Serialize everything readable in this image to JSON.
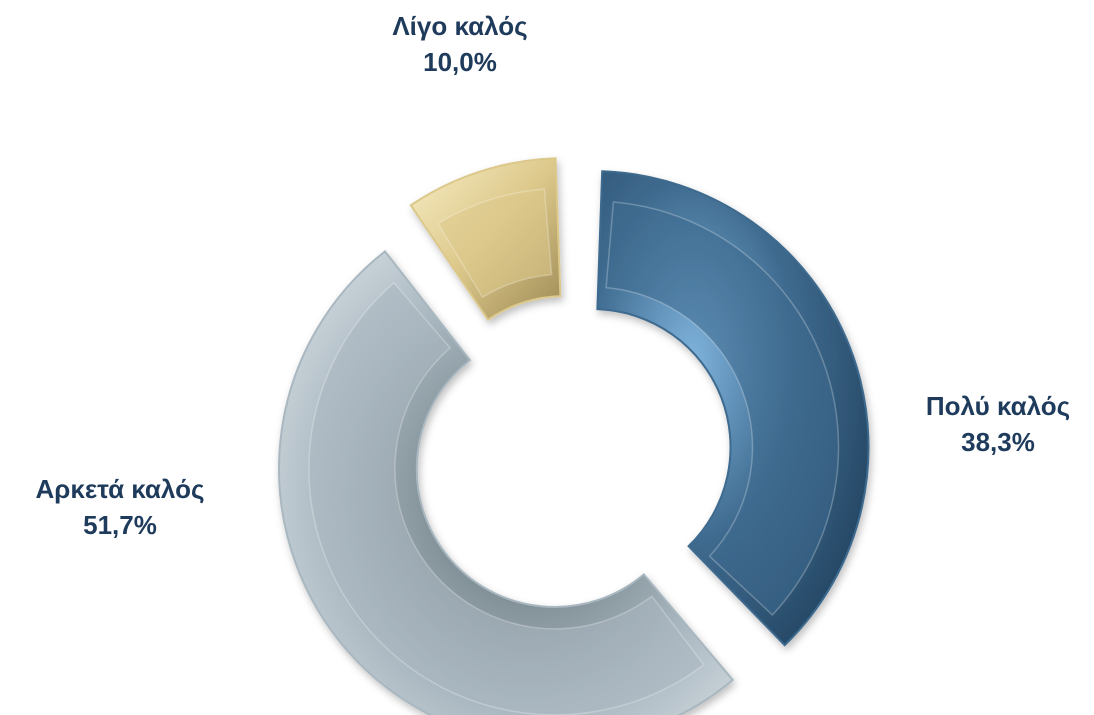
{
  "chart_data": {
    "type": "pie",
    "style": "exploded doughnut",
    "categories": [
      "Πολύ καλός",
      "Αρκετά καλός",
      "Λίγο καλός"
    ],
    "values": [
      38.3,
      51.7,
      10.0
    ],
    "value_labels": [
      "38,3%",
      "51,7%",
      "10,0%"
    ],
    "colors": [
      "#3e6a8e",
      "#a9b7c0",
      "#dcc88a"
    ],
    "legend": "none"
  }
}
